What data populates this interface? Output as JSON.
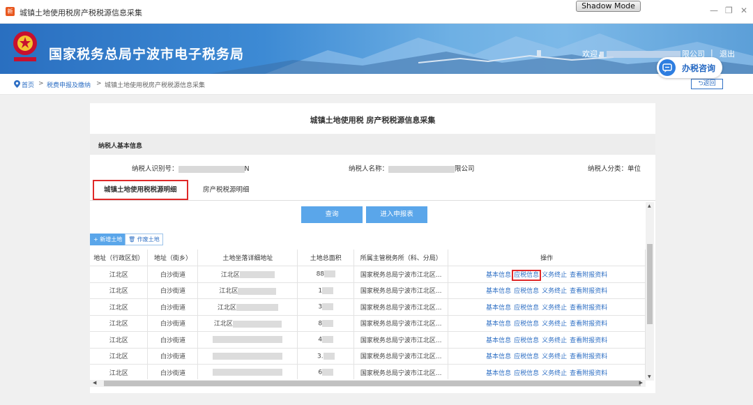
{
  "window": {
    "icon_text": "新",
    "title": "城镇土地使用税房产税税源信息采集",
    "shadow_mode": "Shadow Mode",
    "controls": [
      "—",
      "❐",
      "✕"
    ]
  },
  "header": {
    "site_title": "国家税务总局宁波市电子税务局",
    "welcome_prefix": "欢迎，",
    "welcome_suffix": "限公司",
    "separator": "|",
    "logout": "退出",
    "consult": "办税咨询"
  },
  "breadcrumb": {
    "home": "首页",
    "sep": ">",
    "level1": "税费申报及缴纳",
    "current": "城镇土地使用税房产税税源信息采集",
    "back": "返回"
  },
  "page": {
    "title": "城镇土地使用税 房产税税源信息采集",
    "section_title": "纳税人基本信息",
    "taxpayer_id_label": "纳税人识别号：",
    "taxpayer_id_suffix": "N",
    "taxpayer_name_label": "纳税人名称：",
    "taxpayer_name_suffix": "限公司",
    "taxpayer_type_label": "纳税人分类：",
    "taxpayer_type_value": "单位"
  },
  "tabs": [
    {
      "label": "城镇土地使用税税源明细",
      "active": true
    },
    {
      "label": "房产税税源明细",
      "active": false
    }
  ],
  "actions": {
    "query": "查询",
    "enter_report": "进入申报表",
    "add_land": "+ 新增土地",
    "void_land": "作废土地"
  },
  "table": {
    "columns": [
      "地址（行政区划）",
      "地址（街乡）",
      "土地坐落详细地址",
      "土地总面积",
      "所属主管税务所（科、分局）",
      "操作"
    ],
    "ops": [
      "基本信息",
      "应税信息",
      "义务终止",
      "查看附报资料"
    ],
    "rows": [
      {
        "district": "江北区",
        "street": "白沙街道",
        "address": "江北区",
        "area": "88",
        "office": "国家税务总局宁波市江北区..."
      },
      {
        "district": "江北区",
        "street": "白沙街道",
        "address": "江北区",
        "area": "1",
        "office": "国家税务总局宁波市江北区..."
      },
      {
        "district": "江北区",
        "street": "白沙街道",
        "address": "江北区",
        "area": "3",
        "office": "国家税务总局宁波市江北区..."
      },
      {
        "district": "江北区",
        "street": "白沙街道",
        "address": "江北区",
        "area": "8",
        "office": "国家税务总局宁波市江北区..."
      },
      {
        "district": "江北区",
        "street": "白沙街道",
        "address": "",
        "area": "4",
        "office": "国家税务总局宁波市江北区..."
      },
      {
        "district": "江北区",
        "street": "白沙街道",
        "address": "",
        "area": "3.",
        "office": "国家税务总局宁波市江北区..."
      },
      {
        "district": "江北区",
        "street": "白沙街道",
        "address": "",
        "area": "6",
        "office": "国家税务总局宁波市江北区..."
      }
    ]
  },
  "colors": {
    "accent": "#2e6fc4",
    "button": "#5aa6ea",
    "highlight": "#e02828"
  }
}
